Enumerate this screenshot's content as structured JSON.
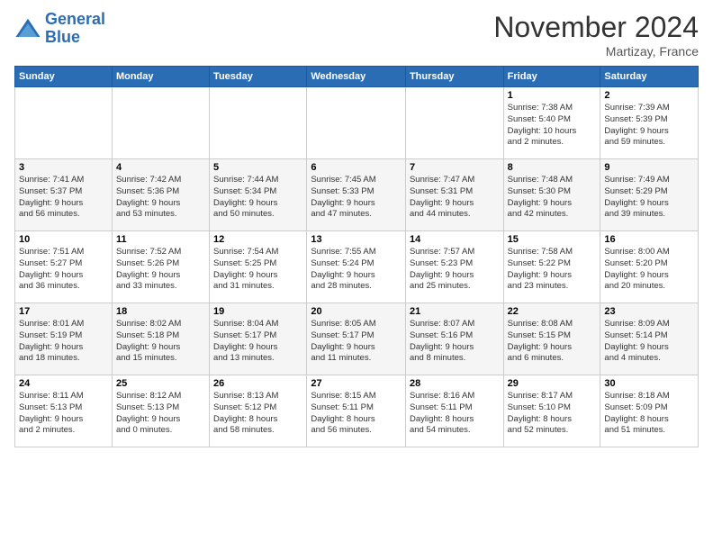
{
  "logo": {
    "line1": "General",
    "line2": "Blue"
  },
  "title": "November 2024",
  "location": "Martizay, France",
  "days_of_week": [
    "Sunday",
    "Monday",
    "Tuesday",
    "Wednesday",
    "Thursday",
    "Friday",
    "Saturday"
  ],
  "weeks": [
    [
      {
        "day": "",
        "info": ""
      },
      {
        "day": "",
        "info": ""
      },
      {
        "day": "",
        "info": ""
      },
      {
        "day": "",
        "info": ""
      },
      {
        "day": "",
        "info": ""
      },
      {
        "day": "1",
        "info": "Sunrise: 7:38 AM\nSunset: 5:40 PM\nDaylight: 10 hours\nand 2 minutes."
      },
      {
        "day": "2",
        "info": "Sunrise: 7:39 AM\nSunset: 5:39 PM\nDaylight: 9 hours\nand 59 minutes."
      }
    ],
    [
      {
        "day": "3",
        "info": "Sunrise: 7:41 AM\nSunset: 5:37 PM\nDaylight: 9 hours\nand 56 minutes."
      },
      {
        "day": "4",
        "info": "Sunrise: 7:42 AM\nSunset: 5:36 PM\nDaylight: 9 hours\nand 53 minutes."
      },
      {
        "day": "5",
        "info": "Sunrise: 7:44 AM\nSunset: 5:34 PM\nDaylight: 9 hours\nand 50 minutes."
      },
      {
        "day": "6",
        "info": "Sunrise: 7:45 AM\nSunset: 5:33 PM\nDaylight: 9 hours\nand 47 minutes."
      },
      {
        "day": "7",
        "info": "Sunrise: 7:47 AM\nSunset: 5:31 PM\nDaylight: 9 hours\nand 44 minutes."
      },
      {
        "day": "8",
        "info": "Sunrise: 7:48 AM\nSunset: 5:30 PM\nDaylight: 9 hours\nand 42 minutes."
      },
      {
        "day": "9",
        "info": "Sunrise: 7:49 AM\nSunset: 5:29 PM\nDaylight: 9 hours\nand 39 minutes."
      }
    ],
    [
      {
        "day": "10",
        "info": "Sunrise: 7:51 AM\nSunset: 5:27 PM\nDaylight: 9 hours\nand 36 minutes."
      },
      {
        "day": "11",
        "info": "Sunrise: 7:52 AM\nSunset: 5:26 PM\nDaylight: 9 hours\nand 33 minutes."
      },
      {
        "day": "12",
        "info": "Sunrise: 7:54 AM\nSunset: 5:25 PM\nDaylight: 9 hours\nand 31 minutes."
      },
      {
        "day": "13",
        "info": "Sunrise: 7:55 AM\nSunset: 5:24 PM\nDaylight: 9 hours\nand 28 minutes."
      },
      {
        "day": "14",
        "info": "Sunrise: 7:57 AM\nSunset: 5:23 PM\nDaylight: 9 hours\nand 25 minutes."
      },
      {
        "day": "15",
        "info": "Sunrise: 7:58 AM\nSunset: 5:22 PM\nDaylight: 9 hours\nand 23 minutes."
      },
      {
        "day": "16",
        "info": "Sunrise: 8:00 AM\nSunset: 5:20 PM\nDaylight: 9 hours\nand 20 minutes."
      }
    ],
    [
      {
        "day": "17",
        "info": "Sunrise: 8:01 AM\nSunset: 5:19 PM\nDaylight: 9 hours\nand 18 minutes."
      },
      {
        "day": "18",
        "info": "Sunrise: 8:02 AM\nSunset: 5:18 PM\nDaylight: 9 hours\nand 15 minutes."
      },
      {
        "day": "19",
        "info": "Sunrise: 8:04 AM\nSunset: 5:17 PM\nDaylight: 9 hours\nand 13 minutes."
      },
      {
        "day": "20",
        "info": "Sunrise: 8:05 AM\nSunset: 5:17 PM\nDaylight: 9 hours\nand 11 minutes."
      },
      {
        "day": "21",
        "info": "Sunrise: 8:07 AM\nSunset: 5:16 PM\nDaylight: 9 hours\nand 8 minutes."
      },
      {
        "day": "22",
        "info": "Sunrise: 8:08 AM\nSunset: 5:15 PM\nDaylight: 9 hours\nand 6 minutes."
      },
      {
        "day": "23",
        "info": "Sunrise: 8:09 AM\nSunset: 5:14 PM\nDaylight: 9 hours\nand 4 minutes."
      }
    ],
    [
      {
        "day": "24",
        "info": "Sunrise: 8:11 AM\nSunset: 5:13 PM\nDaylight: 9 hours\nand 2 minutes."
      },
      {
        "day": "25",
        "info": "Sunrise: 8:12 AM\nSunset: 5:13 PM\nDaylight: 9 hours\nand 0 minutes."
      },
      {
        "day": "26",
        "info": "Sunrise: 8:13 AM\nSunset: 5:12 PM\nDaylight: 8 hours\nand 58 minutes."
      },
      {
        "day": "27",
        "info": "Sunrise: 8:15 AM\nSunset: 5:11 PM\nDaylight: 8 hours\nand 56 minutes."
      },
      {
        "day": "28",
        "info": "Sunrise: 8:16 AM\nSunset: 5:11 PM\nDaylight: 8 hours\nand 54 minutes."
      },
      {
        "day": "29",
        "info": "Sunrise: 8:17 AM\nSunset: 5:10 PM\nDaylight: 8 hours\nand 52 minutes."
      },
      {
        "day": "30",
        "info": "Sunrise: 8:18 AM\nSunset: 5:09 PM\nDaylight: 8 hours\nand 51 minutes."
      }
    ]
  ]
}
